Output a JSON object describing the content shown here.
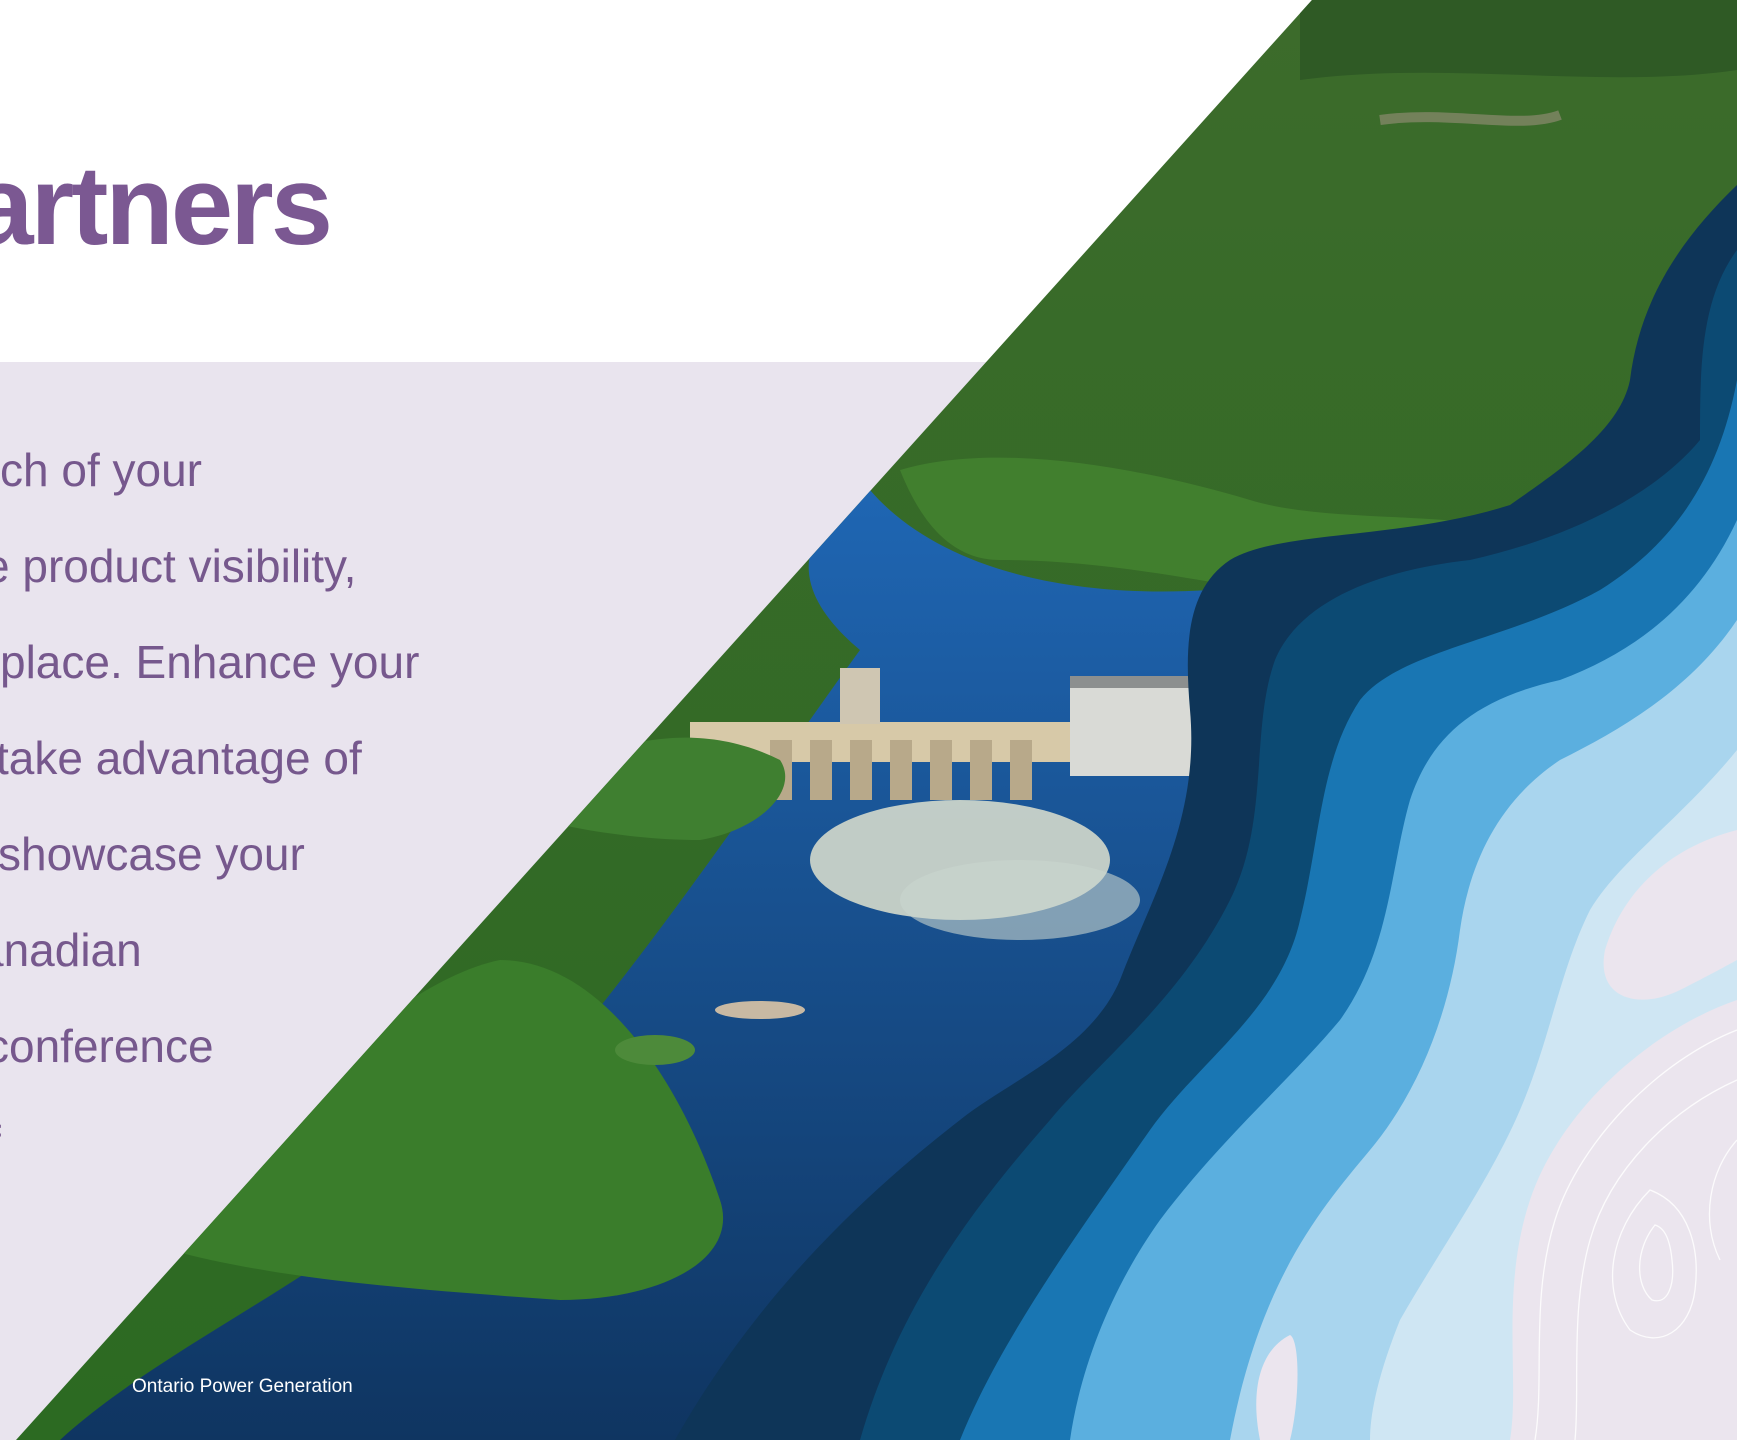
{
  "slide": {
    "title": "artners",
    "body_lines": [
      "ch of your",
      "e product visibility,",
      "place. Enhance your",
      "take advantage of",
      "showcase your",
      "anadian",
      "conference",
      "f"
    ],
    "photo_credit": "Ontario Power Generation"
  },
  "colors": {
    "title": "#7b5892",
    "body_text": "#76588d",
    "lavender_panel": "#e9e4ee",
    "deep_navy": "#0e3558",
    "ocean_blue": "#1976b3",
    "sky_blue": "#5bafdf",
    "pale_blue": "#cfe6f3"
  },
  "icons": {
    "photo": "hydro-dam-aerial-photo",
    "decor": "topographic-water-layers"
  }
}
